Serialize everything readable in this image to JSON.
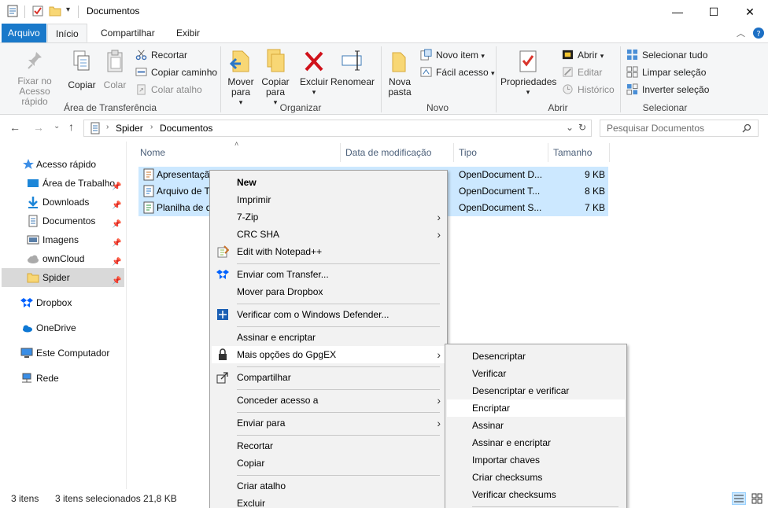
{
  "window": {
    "title": "Documentos",
    "minimize": "—",
    "maximize": "☐",
    "close": "✕"
  },
  "ribbon_tabs": [
    "Arquivo",
    "Início",
    "Compartilhar",
    "Exibir"
  ],
  "ribbon": {
    "clipboard": {
      "pin": "Fixar no Acesso rápido",
      "copy": "Copiar",
      "paste": "Colar",
      "cut": "Recortar",
      "copy_path": "Copiar caminho",
      "paste_shortcut": "Colar atalho",
      "group": "Área de Transferência"
    },
    "organize": {
      "move_to": "Mover para",
      "copy_to": "Copiar para",
      "delete": "Excluir",
      "rename": "Renomear",
      "group": "Organizar"
    },
    "new": {
      "new_folder": "Nova pasta",
      "new_item": "Novo item",
      "easy_access": "Fácil acesso",
      "group": "Novo"
    },
    "open": {
      "properties": "Propriedades",
      "open": "Abrir",
      "edit": "Editar",
      "history": "Histórico",
      "group": "Abrir"
    },
    "select": {
      "select_all": "Selecionar tudo",
      "select_none": "Limpar seleção",
      "invert": "Inverter seleção",
      "group": "Selecionar"
    }
  },
  "address": {
    "path": [
      "Spider",
      "Documentos"
    ],
    "search_placeholder": "Pesquisar Documentos"
  },
  "nav": [
    {
      "label": "Acesso rápido",
      "icon": "star-icon"
    },
    {
      "label": "Área de Trabalho",
      "icon": "desktop-icon"
    },
    {
      "label": "Downloads",
      "icon": "download-icon"
    },
    {
      "label": "Documentos",
      "icon": "documents-icon"
    },
    {
      "label": "Imagens",
      "icon": "images-icon"
    },
    {
      "label": "ownCloud",
      "icon": "cloud-icon"
    },
    {
      "label": "Spider",
      "icon": "folder-icon"
    },
    {
      "label": "Dropbox",
      "icon": "dropbox-icon"
    },
    {
      "label": "OneDrive",
      "icon": "onedrive-icon"
    },
    {
      "label": "Este Computador",
      "icon": "computer-icon"
    },
    {
      "label": "Rede",
      "icon": "network-icon"
    }
  ],
  "columns": [
    "Nome",
    "Data de modificação",
    "Tipo",
    "Tamanho"
  ],
  "files": [
    {
      "name": "Apresentaçã",
      "type": "OpenDocument D...",
      "size": "9 KB"
    },
    {
      "name": "Arquivo de T",
      "type": "OpenDocument T...",
      "size": "8 KB"
    },
    {
      "name": "Planilha de d",
      "type": "OpenDocument S...",
      "size": "7 KB"
    }
  ],
  "context_menu": [
    "New",
    "Imprimir",
    "7-Zip",
    "CRC SHA",
    "Edit with Notepad++",
    "Enviar com Transfer...",
    "Mover para Dropbox",
    "Verificar com o Windows Defender...",
    "Assinar e encriptar",
    "Mais opções do GpgEX",
    "Compartilhar",
    "Conceder acesso a",
    "Enviar para",
    "Recortar",
    "Copiar",
    "Criar atalho",
    "Excluir"
  ],
  "submenu": [
    "Desencriptar",
    "Verificar",
    "Desencriptar e verificar",
    "Encriptar",
    "Assinar",
    "Assinar e encriptar",
    "Importar chaves",
    "Criar checksums",
    "Verificar checksums"
  ],
  "status": {
    "items": "3 itens",
    "selected": "3 itens selecionados",
    "size": "21,8 KB"
  }
}
